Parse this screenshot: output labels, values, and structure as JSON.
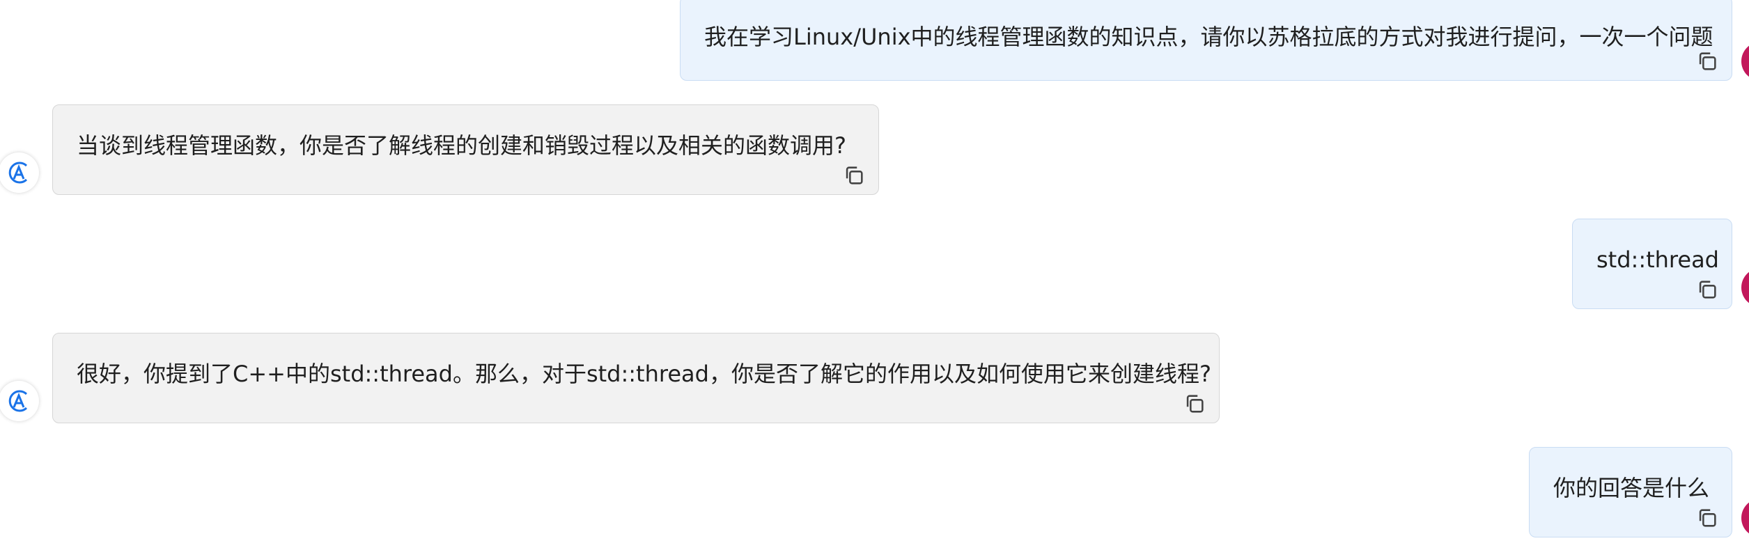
{
  "messages": [
    {
      "role": "user",
      "text": "我在学习Linux/Unix中的线程管理函数的知识点，请你以苏格拉底的方式对我进行提问，一次一个问题"
    },
    {
      "role": "assistant",
      "text": "当谈到线程管理函数，你是否了解线程的创建和销毁过程以及相关的函数调用?"
    },
    {
      "role": "user",
      "text": "std::thread"
    },
    {
      "role": "assistant",
      "text": "很好，你提到了C++中的std::thread。那么，对于std::thread，你是否了解它的作用以及如何使用它来创建线程?"
    },
    {
      "role": "user",
      "text": "你的回答是什么"
    }
  ],
  "icons": {
    "copy": "copy-icon",
    "assistant_avatar": "assistant-logo-icon",
    "user_avatar": "user-avatar"
  },
  "colors": {
    "user_bubble": "#eaf3fd",
    "assistant_bubble": "#f2f2f2",
    "assistant_logo": "#1a73e8",
    "user_avatar": "#c2185b"
  }
}
